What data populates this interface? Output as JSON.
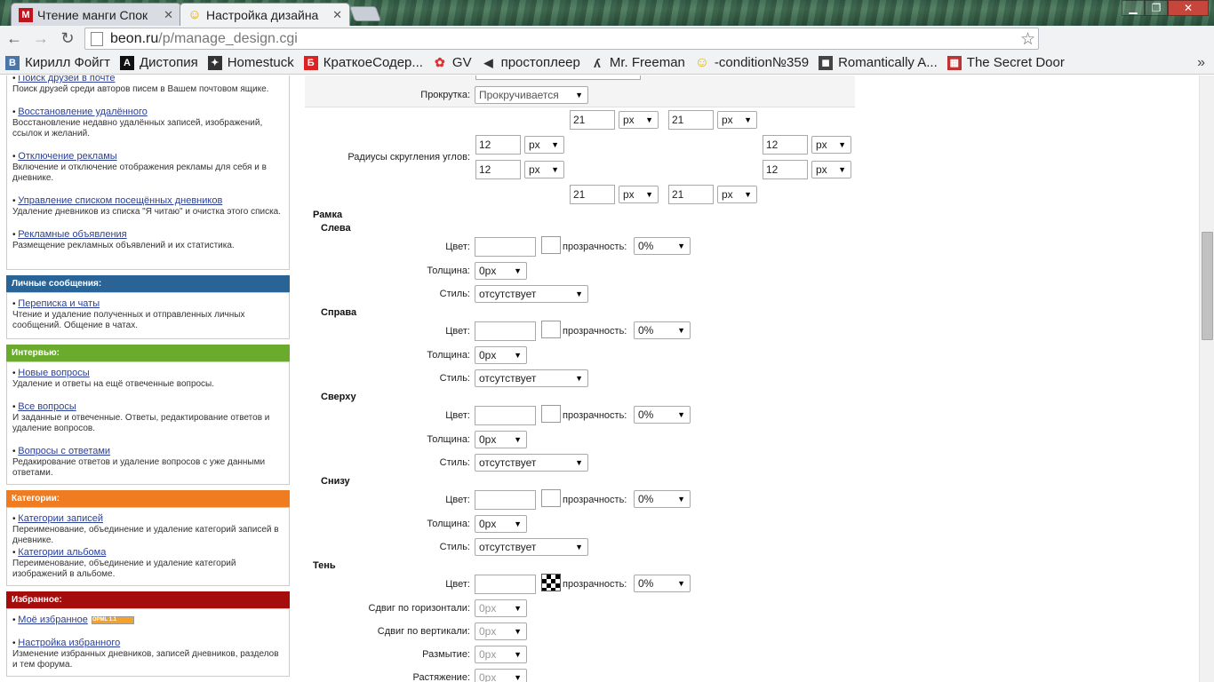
{
  "browser": {
    "tabs": [
      {
        "title": "Чтение манги Спок",
        "favicon": "М",
        "favicon_color": "#c0141c"
      },
      {
        "title": "Настройка дизайна",
        "favicon": "☺",
        "favicon_color": "#f5c518"
      }
    ],
    "url_host": "beon.ru",
    "url_path": "/p/manage_design.cgi"
  },
  "bookmarks": [
    {
      "label": "Кирилл Фойгт",
      "icon": "В",
      "color": "#4a76a8"
    },
    {
      "label": "Дистопия",
      "icon": "A",
      "color": "#111"
    },
    {
      "label": "Homestuck",
      "icon": "✦",
      "color": "#333"
    },
    {
      "label": "КраткоеСодер...",
      "icon": "Б",
      "color": "#d22"
    },
    {
      "label": "GV",
      "icon": "✿",
      "color": "#d33"
    },
    {
      "label": "простоплеер",
      "icon": "◀",
      "color": "#333"
    },
    {
      "label": "Mr. Freeman",
      "icon": "ʎ",
      "color": "#333"
    },
    {
      "label": "-condition№359",
      "icon": "☺",
      "color": "#e2b400"
    },
    {
      "label": "Romantically A...",
      "icon": "◼",
      "color": "#444"
    },
    {
      "label": "The Secret Door",
      "icon": "▦",
      "color": "#b33"
    }
  ],
  "sidebar": {
    "box1_items": [
      {
        "link": "Поиск друзей в почте",
        "desc": "Поиск друзей среди авторов писем в Вашем почтовом ящике."
      },
      {
        "link": "Восстановление удалённого",
        "desc": "Восстановление недавно удалённых записей, изображений, ссылок и желаний."
      },
      {
        "link": "Отключение рекламы",
        "desc": "Включение и отключение отображения рекламы для себя и в дневнике."
      },
      {
        "link": "Управление списком посещённых дневников",
        "desc": "Удаление дневников из списка \"Я читаю\" и очистка этого списка."
      },
      {
        "link": "Рекламные объявления",
        "desc": "Размещение рекламных объявлений и их статистика."
      }
    ],
    "messages_head": "Личные сообщения:",
    "messages_items": [
      {
        "link": "Переписка и чаты",
        "desc": "Чтение и удаление полученных и отправленных личных сообщений. Общение в чатах."
      }
    ],
    "interview_head": "Интервью:",
    "interview_items": [
      {
        "link": "Новые вопросы",
        "desc": "Удаление и ответы на ещё отвеченные вопросы."
      },
      {
        "link": "Все вопросы",
        "desc": "И заданные и отвеченные. Ответы, редактирование ответов и удаление вопросов."
      },
      {
        "link": "Вопросы с ответами",
        "desc": "Редакирование ответов и удаление вопросов с уже данными ответами."
      }
    ],
    "categories_head": "Категории:",
    "categories_items": [
      {
        "link": "Категории записей",
        "desc": "Переименование, объединение и удаление категорий записей в дневнике."
      },
      {
        "link": "Категории альбома",
        "desc": "Переименование, объединение и удаление категорий изображений в альбоме."
      }
    ],
    "favorites_head": "Избранное:",
    "favorites_items": [
      {
        "link": "Моё избранное",
        "desc": ""
      },
      {
        "link": "Настройка избранного",
        "desc": "Изменение избранных дневников, записей дневников, разделов и тем форума."
      }
    ],
    "opml": "OPML 1.1",
    "colors": {
      "messages": "#2a6496",
      "interview": "#6aab2e",
      "categories": "#f07c22",
      "favorites": "#a50c0c"
    }
  },
  "form": {
    "scroll_label": "Прокрутка:",
    "scroll_value": "Прокручивается",
    "radius_label": "Радиусы скругления углов:",
    "radius_value": "21",
    "radius_value2": "12",
    "unit": "px",
    "frame_label": "Рамка",
    "sides": [
      "Слева",
      "Справа",
      "Сверху",
      "Снизу"
    ],
    "color_label": "Цвет:",
    "transparency_label": "прозрачность:",
    "transparency_value": "0%",
    "thickness_label": "Толщина:",
    "thickness_value": "0px",
    "style_label": "Стиль:",
    "style_value": "отсутствует",
    "shadow_label": "Тень",
    "shadow_h_label": "Сдвиг по горизонтали:",
    "shadow_v_label": "Сдвиг по вертикали:",
    "blur_label": "Размытие:",
    "spread_label": "Растяжение:"
  }
}
